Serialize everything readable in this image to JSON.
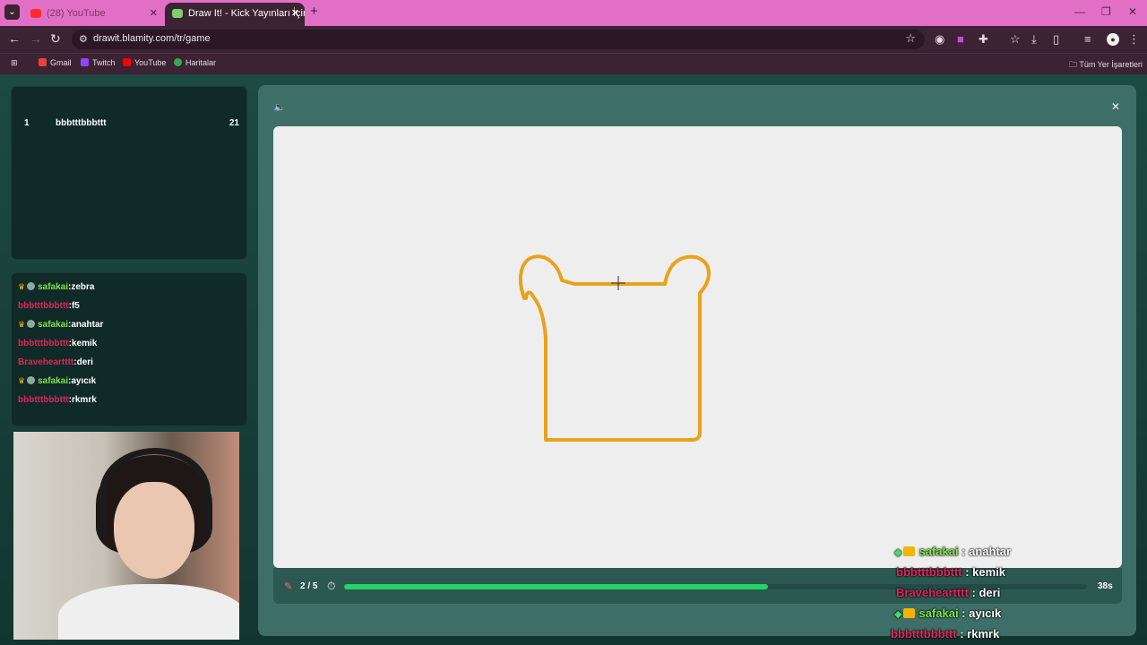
{
  "browser": {
    "tabs": [
      {
        "title": "(28) YouTube",
        "active": false
      },
      {
        "title": "Draw It! - Kick Yayınları İçin Çiz",
        "active": true
      }
    ],
    "url": "drawit.blamity.com/tr/game",
    "bookmarks": [
      "Gmail",
      "Twitch",
      "YouTube",
      "Haritalar"
    ],
    "bookmarks_folder": "Tüm Yer İşaretleri"
  },
  "leaderboard": [
    {
      "rank": "1",
      "name": "bbbtttbbbttt",
      "score": "21"
    }
  ],
  "chat": [
    {
      "user": "safakai",
      "msg": ":zebra",
      "color": "#7ee34b",
      "badges": true
    },
    {
      "user": "bbbtttbbbttt",
      "msg": ":f5",
      "color": "#e0245e",
      "badges": false
    },
    {
      "user": "safakai",
      "msg": ":anahtar",
      "color": "#7ee34b",
      "badges": true
    },
    {
      "user": "bbbtttbbbttt",
      "msg": ":kemik",
      "color": "#e0245e",
      "badges": false
    },
    {
      "user": "Braveheartttt",
      "msg": ":deri",
      "color": "#e0245e",
      "badges": false
    },
    {
      "user": "safakai",
      "msg": ":ayıcık",
      "color": "#7ee34b",
      "badges": true
    },
    {
      "user": "bbbtttbbbttt",
      "msg": ":rkmrk",
      "color": "#e0245e",
      "badges": false
    }
  ],
  "game": {
    "round": "2 / 5",
    "progress_percent": 57,
    "time_left": "38s",
    "stroke_color": "#e8a21b"
  },
  "overlay_chat": [
    {
      "user": "safakai",
      "msg": " : anahtar",
      "color": "#7ee34b",
      "badges": true
    },
    {
      "user": "bbbtttbbbttt",
      "msg": " : kemik",
      "color": "#e0245e",
      "badges": false
    },
    {
      "user": "Braveheartttt",
      "msg": " : deri",
      "color": "#e0245e",
      "badges": false
    },
    {
      "user": "safakai",
      "msg": " : ayıcık",
      "color": "#7ee34b",
      "badges": true
    },
    {
      "user": "bbbtttbbbttt",
      "msg": " : rkmrk",
      "color": "#e0245e",
      "badges": false
    }
  ]
}
